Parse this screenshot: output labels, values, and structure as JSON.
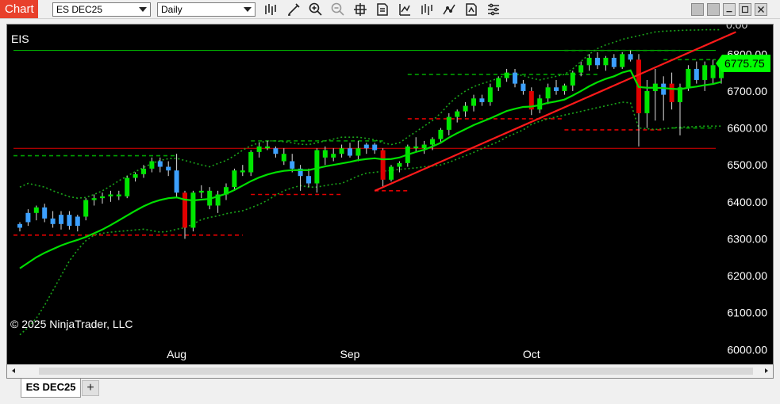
{
  "window": {
    "tab_label": "Chart",
    "instrument": "ES DEC25",
    "period": "Daily"
  },
  "toolbar_icons": [
    "bar-type-icon",
    "draw-pencil-icon",
    "zoom-in-icon",
    "zoom-out-icon",
    "crosshair-icon",
    "data-box-icon",
    "indicators-icon",
    "strategies-icon",
    "drawing-tools-icon",
    "templates-icon",
    "properties-icon"
  ],
  "chart": {
    "instrument_label": "EIS",
    "copyright": "© 2025 NinjaTrader, LLC",
    "last_price_label": "6775.75",
    "top_cut_label": "0.00"
  },
  "tabs": {
    "active": "ES DEC25",
    "add_label": "+"
  },
  "colors": {
    "up": "#00e600",
    "up_alt": "#3ca0ff",
    "down": "#e00000",
    "ma": "#00e000",
    "band": "#1aa51a",
    "trend": "#ff1a1a",
    "support_red": "#ff2a2a",
    "support_green": "#00b300"
  },
  "chart_data": {
    "type": "candlestick",
    "xlabel": "",
    "ylabel": "",
    "ylim": [
      5960,
      6880
    ],
    "y_ticks": [
      "6800.00",
      "6700.00",
      "6600.00",
      "6500.00",
      "6400.00",
      "6300.00",
      "6200.00",
      "6100.00",
      "6000.00"
    ],
    "y_tick_values": [
      6800,
      6700,
      6600,
      6500,
      6400,
      6300,
      6200,
      6100,
      6000
    ],
    "x_labels": [
      {
        "label": "Aug",
        "index": 19
      },
      {
        "label": "Sep",
        "index": 40
      },
      {
        "label": "Oct",
        "index": 62
      }
    ],
    "candles": [
      [
        6330,
        6345,
        6320,
        6340,
        "up_alt"
      ],
      [
        6345,
        6380,
        6335,
        6370,
        "up_alt"
      ],
      [
        6370,
        6390,
        6350,
        6385,
        "up"
      ],
      [
        6385,
        6395,
        6345,
        6355,
        "up_alt"
      ],
      [
        6355,
        6375,
        6330,
        6340,
        "up_alt"
      ],
      [
        6340,
        6375,
        6325,
        6365,
        "up_alt"
      ],
      [
        6365,
        6375,
        6325,
        6335,
        "up_alt"
      ],
      [
        6335,
        6365,
        6320,
        6360,
        "up_alt"
      ],
      [
        6360,
        6410,
        6350,
        6405,
        "up"
      ],
      [
        6405,
        6420,
        6390,
        6410,
        "up"
      ],
      [
        6410,
        6425,
        6395,
        6415,
        "up"
      ],
      [
        6415,
        6430,
        6400,
        6420,
        "up"
      ],
      [
        6420,
        6430,
        6405,
        6415,
        "up"
      ],
      [
        6415,
        6470,
        6410,
        6465,
        "up"
      ],
      [
        6465,
        6480,
        6455,
        6475,
        "up"
      ],
      [
        6475,
        6500,
        6465,
        6490,
        "up"
      ],
      [
        6490,
        6520,
        6480,
        6510,
        "up"
      ],
      [
        6510,
        6520,
        6480,
        6495,
        "up_alt"
      ],
      [
        6495,
        6510,
        6470,
        6485,
        "up_alt"
      ],
      [
        6485,
        6530,
        6410,
        6425,
        "up_alt"
      ],
      [
        6425,
        6430,
        6300,
        6330,
        "down"
      ],
      [
        6330,
        6430,
        6320,
        6425,
        "up"
      ],
      [
        6425,
        6445,
        6410,
        6430,
        "up"
      ],
      [
        6430,
        6440,
        6380,
        6390,
        "up"
      ],
      [
        6390,
        6430,
        6370,
        6420,
        "up"
      ],
      [
        6420,
        6450,
        6405,
        6440,
        "up"
      ],
      [
        6440,
        6490,
        6430,
        6485,
        "up"
      ],
      [
        6485,
        6500,
        6470,
        6480,
        "up"
      ],
      [
        6480,
        6540,
        6470,
        6535,
        "up"
      ],
      [
        6535,
        6560,
        6520,
        6550,
        "up"
      ],
      [
        6550,
        6565,
        6540,
        6545,
        "up"
      ],
      [
        6545,
        6550,
        6520,
        6530,
        "up_alt"
      ],
      [
        6530,
        6545,
        6500,
        6510,
        "up"
      ],
      [
        6510,
        6530,
        6480,
        6490,
        "up_alt"
      ],
      [
        6490,
        6500,
        6430,
        6470,
        "up_alt"
      ],
      [
        6470,
        6490,
        6440,
        6450,
        "up_alt"
      ],
      [
        6450,
        6545,
        6425,
        6540,
        "up"
      ],
      [
        6540,
        6550,
        6500,
        6520,
        "up"
      ],
      [
        6520,
        6545,
        6510,
        6530,
        "up"
      ],
      [
        6530,
        6555,
        6520,
        6545,
        "up"
      ],
      [
        6545,
        6560,
        6520,
        6525,
        "up_alt"
      ],
      [
        6525,
        6565,
        6510,
        6545,
        "up"
      ],
      [
        6545,
        6560,
        6530,
        6555,
        "up_alt"
      ],
      [
        6555,
        6560,
        6530,
        6540,
        "up_alt"
      ],
      [
        6540,
        6545,
        6440,
        6460,
        "down"
      ],
      [
        6460,
        6500,
        6455,
        6495,
        "up"
      ],
      [
        6495,
        6510,
        6480,
        6505,
        "up"
      ],
      [
        6505,
        6555,
        6495,
        6550,
        "up"
      ],
      [
        6550,
        6575,
        6535,
        6545,
        "up"
      ],
      [
        6545,
        6565,
        6530,
        6555,
        "up"
      ],
      [
        6555,
        6575,
        6540,
        6570,
        "up"
      ],
      [
        6570,
        6600,
        6560,
        6595,
        "up"
      ],
      [
        6595,
        6640,
        6580,
        6630,
        "up"
      ],
      [
        6630,
        6650,
        6615,
        6645,
        "up"
      ],
      [
        6645,
        6670,
        6630,
        6660,
        "up"
      ],
      [
        6660,
        6690,
        6645,
        6680,
        "up"
      ],
      [
        6680,
        6690,
        6660,
        6670,
        "up_alt"
      ],
      [
        6670,
        6720,
        6660,
        6710,
        "up"
      ],
      [
        6710,
        6740,
        6700,
        6735,
        "up"
      ],
      [
        6735,
        6760,
        6725,
        6750,
        "up"
      ],
      [
        6750,
        6760,
        6710,
        6720,
        "up_alt"
      ],
      [
        6720,
        6730,
        6690,
        6700,
        "up_alt"
      ],
      [
        6700,
        6710,
        6635,
        6650,
        "down"
      ],
      [
        6650,
        6690,
        6640,
        6680,
        "up"
      ],
      [
        6680,
        6720,
        6665,
        6710,
        "up"
      ],
      [
        6710,
        6730,
        6690,
        6700,
        "up_alt"
      ],
      [
        6700,
        6720,
        6690,
        6715,
        "up"
      ],
      [
        6715,
        6755,
        6700,
        6750,
        "up"
      ],
      [
        6750,
        6780,
        6740,
        6770,
        "up"
      ],
      [
        6770,
        6800,
        6755,
        6790,
        "up"
      ],
      [
        6790,
        6805,
        6760,
        6770,
        "up_alt"
      ],
      [
        6770,
        6795,
        6755,
        6790,
        "up"
      ],
      [
        6790,
        6800,
        6760,
        6765,
        "up_alt"
      ],
      [
        6765,
        6805,
        6760,
        6800,
        "up"
      ],
      [
        6800,
        6810,
        6780,
        6785,
        "up_alt"
      ],
      [
        6785,
        6800,
        6550,
        6640,
        "down"
      ],
      [
        6640,
        6730,
        6600,
        6700,
        "up"
      ],
      [
        6700,
        6760,
        6620,
        6720,
        "up"
      ],
      [
        6720,
        6740,
        6620,
        6690,
        "up_alt"
      ],
      [
        6720,
        6750,
        6650,
        6670,
        "down"
      ],
      [
        6670,
        6720,
        6580,
        6710,
        "up"
      ],
      [
        6710,
        6770,
        6700,
        6760,
        "up"
      ],
      [
        6760,
        6780,
        6720,
        6730,
        "up_alt"
      ],
      [
        6730,
        6780,
        6700,
        6770,
        "up"
      ],
      [
        6770,
        6785,
        6720,
        6735,
        "up"
      ],
      [
        6735,
        6780,
        6720,
        6775,
        "up"
      ]
    ],
    "moving_average": [
      6220,
      6235,
      6250,
      6262,
      6272,
      6282,
      6290,
      6297,
      6305,
      6315,
      6325,
      6337,
      6350,
      6363,
      6376,
      6388,
      6398,
      6405,
      6410,
      6412,
      6406,
      6404,
      6406,
      6408,
      6415,
      6422,
      6432,
      6444,
      6456,
      6466,
      6474,
      6480,
      6484,
      6486,
      6486,
      6486,
      6491,
      6496,
      6500,
      6504,
      6508,
      6513,
      6516,
      6518,
      6515,
      6516,
      6520,
      6528,
      6535,
      6541,
      6550,
      6560,
      6574,
      6586,
      6597,
      6608,
      6617,
      6626,
      6636,
      6646,
      6652,
      6657,
      6658,
      6662,
      6668,
      6672,
      6677,
      6688,
      6700,
      6713,
      6724,
      6733,
      6740,
      6750,
      6756,
      6711,
      6709,
      6709,
      6708,
      6706,
      6705,
      6709,
      6712,
      6716,
      6719,
      6725
    ],
    "upper_band": [
      6440,
      6450,
      6445,
      6440,
      6430,
      6422,
      6414,
      6410,
      6412,
      6420,
      6430,
      6443,
      6457,
      6470,
      6482,
      6493,
      6504,
      6512,
      6517,
      6518,
      6512,
      6506,
      6500,
      6495,
      6504,
      6512,
      6525,
      6540,
      6552,
      6560,
      6565,
      6565,
      6563,
      6560,
      6556,
      6555,
      6560,
      6565,
      6570,
      6575,
      6575,
      6575,
      6572,
      6568,
      6560,
      6555,
      6560,
      6575,
      6590,
      6605,
      6620,
      6640,
      6665,
      6685,
      6700,
      6712,
      6720,
      6727,
      6735,
      6745,
      6745,
      6742,
      6735,
      6730,
      6735,
      6740,
      6745,
      6760,
      6780,
      6800,
      6815,
      6825,
      6832,
      6840,
      6845,
      6850,
      6855,
      6860,
      6862,
      6863,
      6864,
      6865,
      6865,
      6866,
      6866,
      6866
    ],
    "lower_band": [
      6040,
      6060,
      6085,
      6120,
      6160,
      6200,
      6240,
      6270,
      6295,
      6310,
      6315,
      6318,
      6320,
      6322,
      6324,
      6326,
      6322,
      6318,
      6320,
      6326,
      6330,
      6340,
      6352,
      6358,
      6362,
      6368,
      6372,
      6376,
      6384,
      6393,
      6404,
      6418,
      6430,
      6438,
      6444,
      6440,
      6440,
      6444,
      6448,
      6450,
      6460,
      6470,
      6478,
      6480,
      6483,
      6485,
      6488,
      6490,
      6492,
      6495,
      6497,
      6500,
      6507,
      6516,
      6525,
      6534,
      6544,
      6554,
      6563,
      6575,
      6585,
      6595,
      6610,
      6618,
      6625,
      6630,
      6635,
      6640,
      6645,
      6650,
      6655,
      6660,
      6665,
      6670,
      6668,
      6600,
      6598,
      6596,
      6598,
      6600,
      6602,
      6603,
      6604,
      6605,
      6605,
      6605
    ],
    "h_lines": [
      {
        "value": 6810,
        "color": "#00cc00",
        "style": "solid",
        "from": 0,
        "to": 85
      },
      {
        "value": 6545,
        "color": "#e00000",
        "style": "solid",
        "from": 0,
        "to": 85
      },
      {
        "value": 6525,
        "color": "#00a000",
        "style": "dashed",
        "from": 0,
        "to": 19
      },
      {
        "value": 6310,
        "color": "#e00000",
        "style": "dashed",
        "from": 0,
        "to": 27
      },
      {
        "value": 6565,
        "color": "#00a000",
        "style": "dashed",
        "from": 28,
        "to": 44
      },
      {
        "value": 6420,
        "color": "#e00000",
        "style": "dashed",
        "from": 28,
        "to": 39
      },
      {
        "value": 6745,
        "color": "#00a000",
        "style": "dashed",
        "from": 47,
        "to": 70
      },
      {
        "value": 6625,
        "color": "#e00000",
        "style": "dashed",
        "from": 47,
        "to": 66
      },
      {
        "value": 6430,
        "color": "#e00000",
        "style": "dashed",
        "from": 43,
        "to": 47
      },
      {
        "value": 6810,
        "color": "#00a000",
        "style": "dashed",
        "from": 66,
        "to": 80
      },
      {
        "value": 6595,
        "color": "#e00000",
        "style": "dashed",
        "from": 66,
        "to": 78
      },
      {
        "value": 6785,
        "color": "#00a000",
        "style": "dashed",
        "from": 78,
        "to": 85
      },
      {
        "value": 6600,
        "color": "#00a000",
        "style": "dashed",
        "from": 79,
        "to": 85
      }
    ],
    "trend_line": {
      "from": [
        43,
        6430
      ],
      "to": [
        86,
        6860
      ]
    }
  }
}
